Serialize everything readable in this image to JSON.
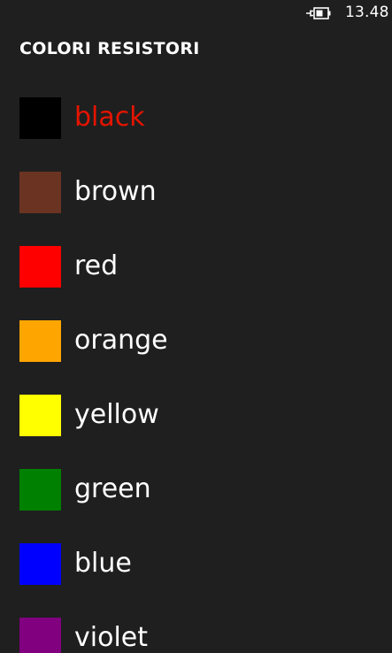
{
  "status_bar": {
    "time": "13.48",
    "battery_icon": "battery-charging-icon"
  },
  "app": {
    "title": "COLORI RESISTORI",
    "accent_color": "#e51400",
    "background_color": "#1f1f1f"
  },
  "colors": [
    {
      "label": "black",
      "swatch": "#000000",
      "selected": true
    },
    {
      "label": "brown",
      "swatch": "#6b3322",
      "selected": false
    },
    {
      "label": "red",
      "swatch": "#ff0000",
      "selected": false
    },
    {
      "label": "orange",
      "swatch": "#ffa500",
      "selected": false
    },
    {
      "label": "yellow",
      "swatch": "#ffff00",
      "selected": false
    },
    {
      "label": "green",
      "swatch": "#008000",
      "selected": false
    },
    {
      "label": "blue",
      "swatch": "#0000ff",
      "selected": false
    },
    {
      "label": "violet",
      "swatch": "#800080",
      "selected": false
    }
  ]
}
